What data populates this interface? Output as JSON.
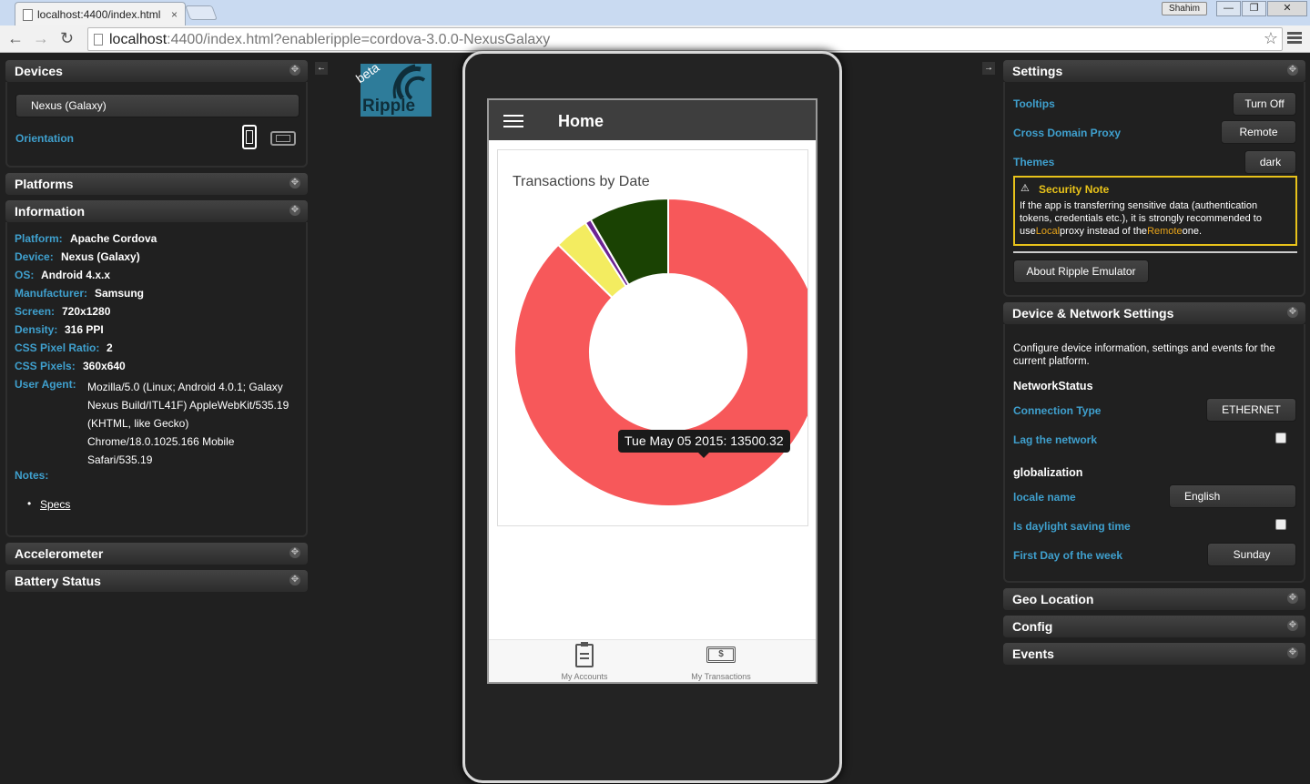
{
  "browser": {
    "tab_title": "localhost:4400/index.html",
    "tab_close": "×",
    "url_host": "localhost",
    "url_rest": ":4400/index.html?enableripple=cordova-3.0.0-NexusGalaxy",
    "user_name": "Shahim",
    "back": "←",
    "forward": "→",
    "reload": "↻",
    "star": "☆",
    "win_min": "—",
    "win_max": "❐",
    "win_close": "✕"
  },
  "ripple": {
    "logo_beta": "beta",
    "logo_text": "Ripple",
    "collapse_left": "←",
    "collapse_right": "→"
  },
  "devices": {
    "title": "Devices",
    "selected_device": "Nexus (Galaxy)",
    "orientation_label": "Orientation"
  },
  "platforms": {
    "title": "Platforms"
  },
  "information": {
    "title": "Information",
    "rows": [
      {
        "label": "Platform:",
        "value": "Apache Cordova"
      },
      {
        "label": "Device:",
        "value": "Nexus (Galaxy)"
      },
      {
        "label": "OS:",
        "value": "Android 4.x.x"
      },
      {
        "label": "Manufacturer:",
        "value": "Samsung"
      },
      {
        "label": "Screen:",
        "value": "720x1280"
      },
      {
        "label": "Density:",
        "value": "316 PPI"
      },
      {
        "label": "CSS Pixel Ratio:",
        "value": "2"
      },
      {
        "label": "CSS Pixels:",
        "value": "360x640"
      }
    ],
    "user_agent_label": "User Agent:",
    "user_agent_lines": [
      "Mozilla/5.0 (Linux; Android 4.0.1; Galaxy",
      "Nexus Build/ITL41F) AppleWebKit/535.19",
      "(KHTML, like Gecko)",
      "Chrome/18.0.1025.166 Mobile",
      "Safari/535.19"
    ],
    "notes_label": "Notes:",
    "notes_link": "Specs"
  },
  "accelerometer": {
    "title": "Accelerometer"
  },
  "battery": {
    "title": "Battery Status"
  },
  "settings": {
    "title": "Settings",
    "tooltips_label": "Tooltips",
    "tooltips_value": "Turn Off",
    "proxy_label": "Cross Domain Proxy",
    "proxy_value": "Remote",
    "themes_label": "Themes",
    "themes_value": "dark",
    "security_title": "Security Note",
    "security_line1": "If the app is transferring sensitive data (authentication",
    "security_line2": "tokens, credentials etc.), it is strongly recommended to",
    "security_use": "use",
    "security_local": "Local",
    "security_mid": "proxy instead of the",
    "security_remote": "Remote",
    "security_end": "one.",
    "about_button": "About Ripple Emulator"
  },
  "device_network": {
    "title": "Device & Network Settings",
    "description_line1": "Configure device information, settings and events for the",
    "description_line2": "current platform.",
    "network_heading": "NetworkStatus",
    "connection_label": "Connection Type",
    "connection_value": "ETHERNET",
    "lag_label": "Lag the network",
    "lag_checked": false,
    "globalization_heading": "globalization",
    "locale_label": "locale name",
    "locale_value": "English",
    "dst_label": "Is daylight saving time",
    "dst_checked": false,
    "first_day_label": "First Day of the week",
    "first_day_value": "Sunday"
  },
  "geo": {
    "title": "Geo Location"
  },
  "config": {
    "title": "Config"
  },
  "events": {
    "title": "Events"
  },
  "app": {
    "header_title": "Home",
    "tooltip_text": "Tue May 05 2015: 13500.32",
    "nav_accounts": "My Accounts",
    "nav_transactions": "My Transactions"
  },
  "chart_data": {
    "type": "pie",
    "title": "Transactions by Date",
    "donut": true,
    "labels": [
      "Tue May 05 2015",
      "",
      "",
      ""
    ],
    "values": [
      13500.32,
      560,
      100,
      1300
    ],
    "colors": [
      "#f7585a",
      "#f3ec60",
      "#6c2393",
      "#1a4203"
    ]
  }
}
